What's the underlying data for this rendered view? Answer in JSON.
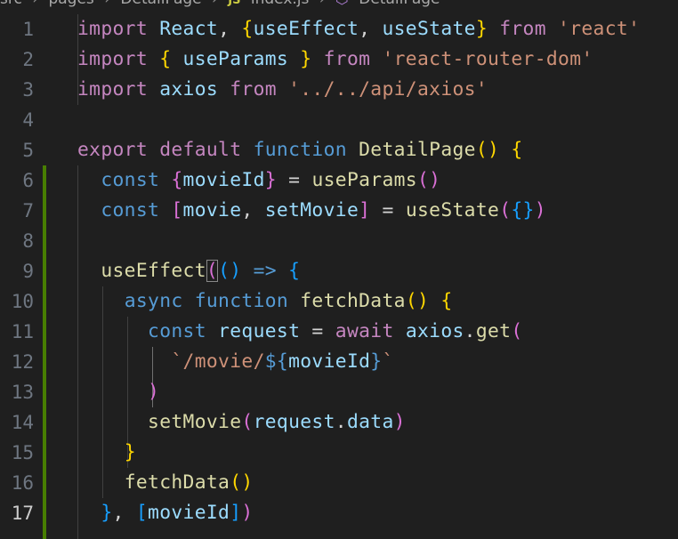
{
  "breadcrumb": {
    "items": [
      "src",
      "pages",
      "DetailPage",
      "index.js",
      "DetailPage"
    ]
  },
  "editor": {
    "active_line": 17,
    "line_numbers": [
      "1",
      "2",
      "3",
      "4",
      "5",
      "6",
      "7",
      "8",
      "9",
      "10",
      "11",
      "12",
      "13",
      "14",
      "15",
      "16",
      "17"
    ],
    "lines": [
      [
        [
          "kw",
          "import"
        ],
        [
          "pl",
          " "
        ],
        [
          "var",
          "React"
        ],
        [
          "pl",
          ", "
        ],
        [
          "b1",
          "{"
        ],
        [
          "var",
          "useEffect"
        ],
        [
          "pl",
          ", "
        ],
        [
          "var",
          "useState"
        ],
        [
          "b1",
          "}"
        ],
        [
          "pl",
          " "
        ],
        [
          "kw",
          "from"
        ],
        [
          "pl",
          " "
        ],
        [
          "str",
          "'react'"
        ]
      ],
      [
        [
          "kw",
          "import"
        ],
        [
          "pl",
          " "
        ],
        [
          "b1",
          "{"
        ],
        [
          "pl",
          " "
        ],
        [
          "var",
          "useParams"
        ],
        [
          "pl",
          " "
        ],
        [
          "b1",
          "}"
        ],
        [
          "pl",
          " "
        ],
        [
          "kw",
          "from"
        ],
        [
          "pl",
          " "
        ],
        [
          "str",
          "'react-router-dom'"
        ]
      ],
      [
        [
          "kw",
          "import"
        ],
        [
          "pl",
          " "
        ],
        [
          "var",
          "axios"
        ],
        [
          "pl",
          " "
        ],
        [
          "kw",
          "from"
        ],
        [
          "pl",
          " "
        ],
        [
          "str",
          "'../../api/axios'"
        ]
      ],
      [],
      [
        [
          "kw",
          "export"
        ],
        [
          "pl",
          " "
        ],
        [
          "kw",
          "default"
        ],
        [
          "pl",
          " "
        ],
        [
          "st",
          "function"
        ],
        [
          "pl",
          " "
        ],
        [
          "fn",
          "DetailPage"
        ],
        [
          "b1",
          "()"
        ],
        [
          "pl",
          " "
        ],
        [
          "b1",
          "{"
        ]
      ],
      [
        [
          "pl",
          "  "
        ],
        [
          "st",
          "const"
        ],
        [
          "pl",
          " "
        ],
        [
          "b2",
          "{"
        ],
        [
          "var",
          "movieId"
        ],
        [
          "b2",
          "}"
        ],
        [
          "pl",
          " = "
        ],
        [
          "fn",
          "useParams"
        ],
        [
          "b2",
          "()"
        ]
      ],
      [
        [
          "pl",
          "  "
        ],
        [
          "st",
          "const"
        ],
        [
          "pl",
          " "
        ],
        [
          "b2",
          "["
        ],
        [
          "var",
          "movie"
        ],
        [
          "pl",
          ", "
        ],
        [
          "var",
          "setMovie"
        ],
        [
          "b2",
          "]"
        ],
        [
          "pl",
          " = "
        ],
        [
          "fn",
          "useState"
        ],
        [
          "b2",
          "("
        ],
        [
          "b3",
          "{}"
        ],
        [
          "b2",
          ")"
        ]
      ],
      [],
      [
        [
          "pl",
          "  "
        ],
        [
          "fn",
          "useEffect"
        ],
        [
          "b2",
          "("
        ],
        [
          "b3",
          "()"
        ],
        [
          "pl",
          " "
        ],
        [
          "st",
          "=>"
        ],
        [
          "pl",
          " "
        ],
        [
          "b3",
          "{"
        ]
      ],
      [
        [
          "pl",
          "    "
        ],
        [
          "st",
          "async"
        ],
        [
          "pl",
          " "
        ],
        [
          "st",
          "function"
        ],
        [
          "pl",
          " "
        ],
        [
          "fn",
          "fetchData"
        ],
        [
          "b1",
          "()"
        ],
        [
          "pl",
          " "
        ],
        [
          "b1",
          "{"
        ]
      ],
      [
        [
          "pl",
          "      "
        ],
        [
          "st",
          "const"
        ],
        [
          "pl",
          " "
        ],
        [
          "var",
          "request"
        ],
        [
          "pl",
          " = "
        ],
        [
          "kw",
          "await"
        ],
        [
          "pl",
          " "
        ],
        [
          "var",
          "axios"
        ],
        [
          "pl",
          "."
        ],
        [
          "fn",
          "get"
        ],
        [
          "b2",
          "("
        ]
      ],
      [
        [
          "pl",
          "        "
        ],
        [
          "str",
          "`/movie/"
        ],
        [
          "ph",
          "${"
        ],
        [
          "var",
          "movieId"
        ],
        [
          "ph",
          "}"
        ],
        [
          "str",
          "`"
        ]
      ],
      [
        [
          "pl",
          "      "
        ],
        [
          "b2",
          ")"
        ]
      ],
      [
        [
          "pl",
          "      "
        ],
        [
          "fn",
          "setMovie"
        ],
        [
          "b2",
          "("
        ],
        [
          "var",
          "request"
        ],
        [
          "pl",
          "."
        ],
        [
          "var",
          "data"
        ],
        [
          "b2",
          ")"
        ]
      ],
      [
        [
          "pl",
          "    "
        ],
        [
          "b1",
          "}"
        ]
      ],
      [
        [
          "pl",
          "    "
        ],
        [
          "fn",
          "fetchData"
        ],
        [
          "b1",
          "()"
        ]
      ],
      [
        [
          "pl",
          "  "
        ],
        [
          "b3",
          "}"
        ],
        [
          "pl",
          ", "
        ],
        [
          "b3",
          "["
        ],
        [
          "var",
          "movieId"
        ],
        [
          "b3",
          "]"
        ],
        [
          "b2",
          ")"
        ]
      ]
    ]
  }
}
